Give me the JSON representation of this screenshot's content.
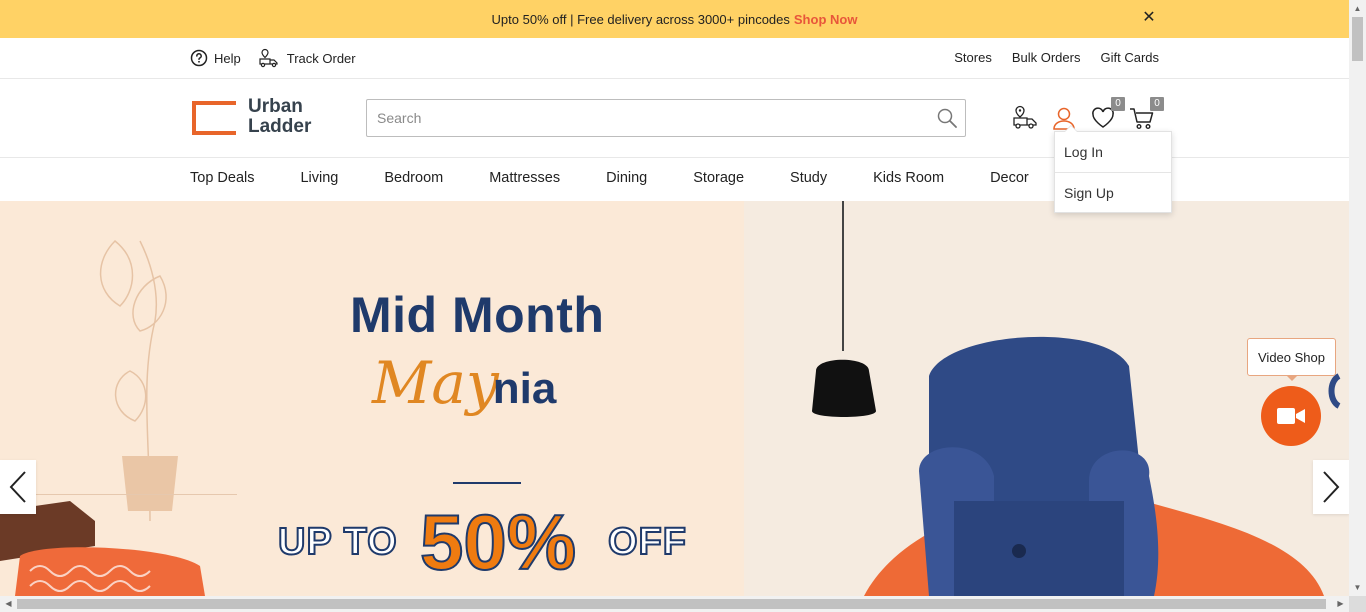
{
  "promo": {
    "text": "Upto 50% off | Free delivery across 3000+ pincodes",
    "link": "Shop Now",
    "close": "✕"
  },
  "utility": {
    "help": "Help",
    "track_order": "Track Order",
    "links": [
      "Stores",
      "Bulk Orders",
      "Gift Cards"
    ]
  },
  "logo": {
    "line1": "Urban",
    "line2": "Ladder",
    "accent": "#e8652a"
  },
  "search": {
    "placeholder": "Search",
    "value": ""
  },
  "header_icons": {
    "wishlist_count": "0",
    "cart_count": "0"
  },
  "account_menu": {
    "items": [
      "Log In",
      "Sign Up"
    ]
  },
  "nav": {
    "items": [
      "Top Deals",
      "Living",
      "Bedroom",
      "Mattresses",
      "Dining",
      "Storage",
      "Study",
      "Kids Room",
      "Decor"
    ]
  },
  "hero": {
    "line1": "Mid Month",
    "line2_script": "May",
    "line2_rest": "nia",
    "upto": "UP TO",
    "percent": "50%",
    "off": "OFF",
    "brand_blue": "#1f3a6b",
    "brand_orange": "#ef7b10"
  },
  "video_shop": {
    "label": "Video Shop",
    "color": "#ee5c1a"
  }
}
